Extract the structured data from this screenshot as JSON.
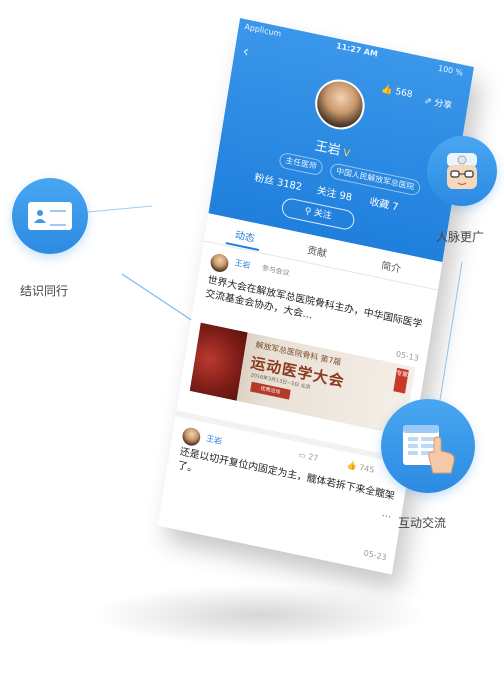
{
  "phone": {
    "status": {
      "carrier": "Applicum",
      "time": "11:27 AM",
      "battery": "100 %"
    },
    "header": {
      "likes": "568",
      "share": "分享",
      "name": "王岩",
      "vip": "V",
      "tag_title": "主任医师",
      "tag_hospital": "中国人民解放军总医院",
      "fans": "粉丝 3182",
      "follow_count": "关注 98",
      "favorites": "收藏 7",
      "follow_button": "关注"
    },
    "tabs": [
      "动态",
      "贡献",
      "简介"
    ],
    "post1": {
      "user": "王岩",
      "action": "参与会议",
      "text": "世界大会在解放军总医院骨科主办，中华国际医学交流基金会协办，大会...",
      "date": "05-13",
      "banner": {
        "line1": "解放军总医院骨科 第7届",
        "main": "运动医学大会",
        "info": "2016年3月13日~5日  北京",
        "button": "优秀活动",
        "corner": "专家"
      }
    },
    "post2": {
      "user": "王岩",
      "comments": "27",
      "likes": "745",
      "text": "还是以切开复位内固定为主，髋体若拆下来全髋架了。",
      "date": "05-23",
      "more": "..."
    }
  },
  "features": [
    {
      "label": "结识同行",
      "icon": "business-card-icon"
    },
    {
      "label": "人脉更广",
      "icon": "doctor-avatar-icon"
    },
    {
      "label": "互动交流",
      "icon": "tap-document-icon"
    }
  ],
  "colors": {
    "brand_blue": "#1f7fdc",
    "bubble_blue": "#3a98ea"
  }
}
